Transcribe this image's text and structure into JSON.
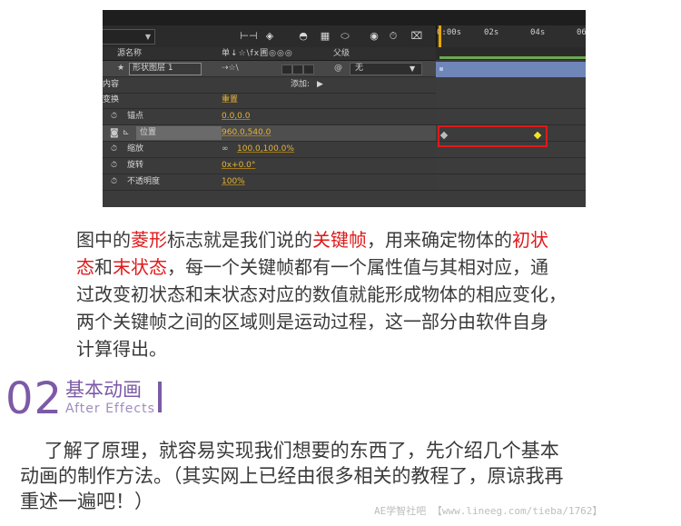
{
  "ae_panel": {
    "toolbar_icons": [
      "shy-layers-icon",
      "3d-layer-icon",
      "motion-blur-icon",
      "adjustment-icon",
      "graph-editor-icon",
      "draft-3d-icon",
      "stopwatch-icon",
      "frame-blending-icon"
    ],
    "ruler": [
      "0:00s",
      "02s",
      "04s",
      "06"
    ],
    "headers": {
      "source_name": "源名称",
      "switches": "单↓☆\\fx圃◎◎◎",
      "parent": "父级"
    },
    "layer": {
      "index": "1",
      "name": "形状图层 1",
      "parent_value": "无",
      "parent_icon": "@"
    },
    "rows": [
      {
        "label": "内容",
        "value": "添加:",
        "value_icon": "▶"
      },
      {
        "label": "变换",
        "value": "重置"
      },
      {
        "label": "锚点",
        "value": "0.0,0.0"
      },
      {
        "label": "位置",
        "value": "960.0,540.0"
      },
      {
        "label": "缩放",
        "value": "100.0,100.0%"
      },
      {
        "label": "旋转",
        "value": "0x+0.0°"
      },
      {
        "label": "不透明度",
        "value": "100%"
      }
    ],
    "keyframes": [
      {
        "time_s": 0.1,
        "color": "#bdbdbd"
      },
      {
        "time_s": 4.0,
        "color": "#f2e41f"
      }
    ],
    "colors": {
      "keyframe_box": "#e0191a",
      "layer_bar": "#6f86b8",
      "value": "#e8b437",
      "work_area": "#6aa84f"
    }
  },
  "paragraph": {
    "l1": [
      "图中的",
      "菱形",
      "标志就是我们说的",
      "关键帧",
      "，用来确定物体的",
      "初状"
    ],
    "l2": [
      "态",
      "和",
      "末状态",
      "，每一个关键帧都有一个属性值与其相对应，通"
    ],
    "l3": "过改变初状态和末状态对应的数值就能形成物体的相应变化，",
    "l4": "两个关键帧之间的区域则是运动过程，这一部分由软件自身",
    "l5": "计算得出。"
  },
  "section": {
    "number": "02",
    "title": "基本动画",
    "subtitle": "After Effects"
  },
  "intro": {
    "l1": "    了解了原理，就容易实现我们想要的东西了，先介绍几个基本",
    "l2": "动画的制作方法。（其实网上已经由很多相关的教程了，原谅我再",
    "l3": "重述一遍吧！）"
  },
  "watermark": "AE学智社吧 【www.lineeg.com/tieba/1762】",
  "colors": {
    "highlight_red": "#e0191a",
    "section_purple": "#7c5aa6",
    "body_text": "#3a3a3a"
  }
}
